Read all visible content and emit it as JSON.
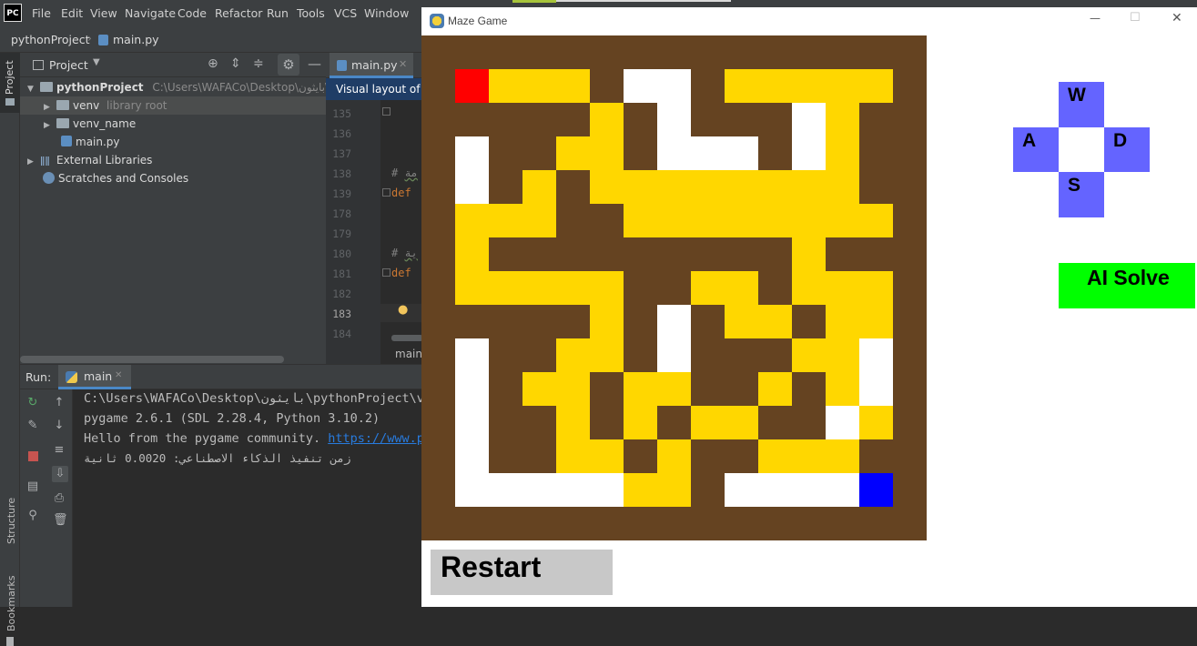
{
  "ide": {
    "logo": "PC",
    "menu": [
      "File",
      "Edit",
      "View",
      "Navigate",
      "Code",
      "Refactor",
      "Run",
      "Tools",
      "VCS",
      "Window"
    ],
    "breadcrumb": {
      "project": "pythonProject",
      "file": "main.py"
    },
    "left_strip": {
      "project": "Project",
      "structure": "Structure",
      "bookmarks": "Bookmarks"
    },
    "project_panel": {
      "title": "Project",
      "root_name": "pythonProject",
      "root_path": "C:\\Users\\WAFACo\\Desktop\\بايثون\\pyth",
      "items": [
        {
          "name": "venv",
          "note": "library root"
        },
        {
          "name": "venv_name",
          "note": ""
        },
        {
          "name": "main.py",
          "note": ""
        },
        {
          "name": "External Libraries",
          "note": ""
        },
        {
          "name": "Scratches and Consoles",
          "note": ""
        }
      ]
    },
    "editor": {
      "tab": "main.py",
      "tooltip": "Visual layout of bi",
      "line_numbers": [
        "135",
        "136",
        "137",
        "138",
        "139",
        "178",
        "179",
        "180",
        "181",
        "182",
        "183",
        "184"
      ],
      "lines": [
        {
          "n": "138",
          "text": "# ",
          "suffix": "مة"
        },
        {
          "n": "139",
          "text": "def"
        },
        {
          "n": "180",
          "text": "# ",
          "suffix": "ية"
        },
        {
          "n": "181",
          "text": "def"
        }
      ],
      "bottom_label": "main"
    },
    "run": {
      "label": "Run:",
      "tab": "main",
      "console": [
        "C:\\Users\\WAFACo\\Desktop\\بايثون\\pythonProject\\ve",
        "pygame 2.6.1 (SDL 2.28.4, Python 3.10.2)",
        "زمن تنفيذ الذكاء الاصطناعي: 0.0020 ثانية"
      ],
      "hello_prefix": "Hello from the pygame community. ",
      "hello_link": "https://www.py"
    }
  },
  "game": {
    "window_title": "Maze Game",
    "title_controls": {
      "minimize": "—",
      "maximize": "☐",
      "close": "✕"
    },
    "colors": {
      "wall": "#654321",
      "path": "#ffffff",
      "solution": "#ffd700",
      "start": "#ff0000",
      "goal": "#0000ff",
      "dpad": "#6464ff",
      "ai_button": "#00ff00",
      "restart_button": "#c8c8c8"
    },
    "maze_grid": [
      "###############",
      "#SOOO#PP#OOOOO#",
      "#####O#P###PO##",
      "#P##OO#PPP#PO##",
      "#P#O#OOOOOOOO##",
      "#OOO##OOOOOOOO#",
      "#O#########O###",
      "#OOOOO##OO#OOO#",
      "#####O#P#OO#OO#",
      "#P##OO#P###OOP#",
      "#P#OO#OO##O#OP#",
      "#P##O#O#OO##PO#",
      "#P##OO#O##OOO##",
      "#PPPPPOO#PPPPG#",
      "###############"
    ],
    "dpad": {
      "up": "W",
      "left": "A",
      "right": "D",
      "down": "S"
    },
    "ai_solve_label": "AI Solve",
    "restart_label": "Restart"
  }
}
